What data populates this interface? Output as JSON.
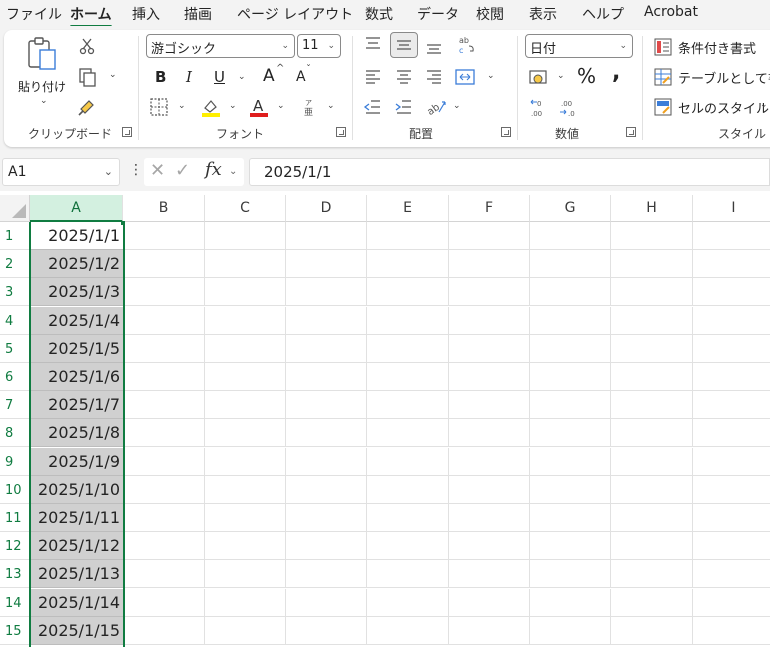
{
  "menu": {
    "tabs": [
      "ファイル",
      "ホーム",
      "挿入",
      "描画",
      "ページ レイアウト",
      "数式",
      "データ",
      "校閲",
      "表示",
      "ヘルプ",
      "Acrobat"
    ],
    "active_tab": "ホーム"
  },
  "ribbon": {
    "clipboard": {
      "paste_label": "貼り付け",
      "group_label": "クリップボード"
    },
    "font": {
      "font_name": "游ゴシック",
      "font_size": "11",
      "bold": "B",
      "italic": "I",
      "underline": "U",
      "grow_font": "A",
      "shrink_font": "A",
      "group_label": "フォント",
      "font_color": "#e01e1e",
      "highlight_color": "#ffef00"
    },
    "alignment": {
      "group_label": "配置"
    },
    "number": {
      "format": "日付",
      "percent": "%",
      "comma": ",",
      "group_label": "数値"
    },
    "styles": {
      "conditional_formatting": "条件付き書式",
      "format_as_table": "テーブルとして書式",
      "cell_styles": "セルのスタイル",
      "group_label": "スタイル"
    }
  },
  "formula_bar": {
    "name_box": "A1",
    "formula": "2025/1/1",
    "fx_label": "fx"
  },
  "sheet": {
    "columns": [
      "A",
      "B",
      "C",
      "D",
      "E",
      "F",
      "G",
      "H",
      "I"
    ],
    "selected_column": "A",
    "active_cell": "A1",
    "rows": [
      "1",
      "2",
      "3",
      "4",
      "5",
      "6",
      "7",
      "8",
      "9",
      "10",
      "11",
      "12",
      "13",
      "14",
      "15"
    ],
    "column_a_values": [
      "2025/1/1",
      "2025/1/2",
      "2025/1/3",
      "2025/1/4",
      "2025/1/5",
      "2025/1/6",
      "2025/1/7",
      "2025/1/8",
      "2025/1/9",
      "2025/1/10",
      "2025/1/11",
      "2025/1/12",
      "2025/1/13",
      "2025/1/14",
      "2025/1/15"
    ]
  },
  "colors": {
    "accent_green": "#107c41",
    "selection_gray": "#d0d0d0",
    "ribbon_bg": "#f3f3f3"
  }
}
